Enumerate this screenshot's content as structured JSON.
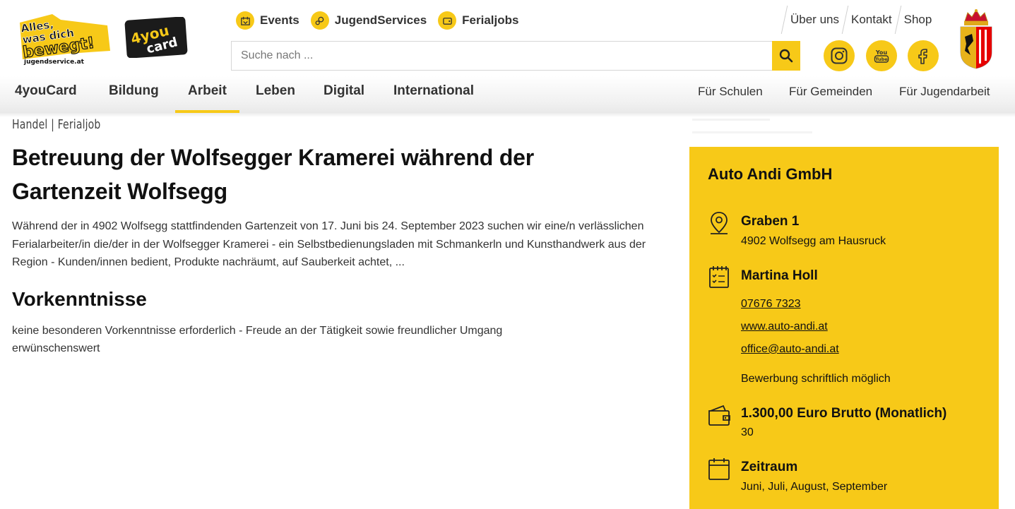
{
  "header": {
    "logo_main_text": [
      "Alles,",
      "was dich",
      "bewegt!",
      "jugendservice.at"
    ],
    "logo_card_text": [
      "4you",
      "card"
    ],
    "topnav": [
      {
        "label": "Events",
        "icon": "events-icon"
      },
      {
        "label": "JugendServices",
        "icon": "jugendservices-icon"
      },
      {
        "label": "Ferialjobs",
        "icon": "ferialjobs-icon"
      }
    ],
    "search": {
      "placeholder": "Suche nach ...",
      "value": ""
    },
    "utilnav": [
      "Über uns",
      "Kontakt",
      "Shop"
    ],
    "social": [
      "instagram-icon",
      "youtube-icon",
      "facebook-icon"
    ],
    "youtube_text": [
      "You",
      "Tube"
    ]
  },
  "mainnav": {
    "items": [
      "4youCard",
      "Bildung",
      "Arbeit",
      "Leben",
      "Digital",
      "International"
    ],
    "active": "Arbeit"
  },
  "subnav": [
    "Für Schulen",
    "Für Gemeinden",
    "Für Jugendarbeit"
  ],
  "article": {
    "breadcrumb": "Handel | Ferialjob",
    "title": "Betreuung der Wolfsegger Kramerei während der Gartenzeit Wolfsegg",
    "intro": "Während der in 4902 Wolfsegg stattfindenden Gartenzeit von 17. Juni bis 24. September 2023 suchen wir eine/n verlässlichen Ferialarbeiter/in die/der in der Wolfsegger Kramerei - ein Selbstbedienungsladen mit Schmankerln und Kunsthandwerk aus der Region - Kunden/innen bedient, Produkte nachräumt, auf Sauberkeit achtet, ...",
    "section_heading": "Vorkenntnisse",
    "section_text": "keine besonderen Vorkenntnisse erforderlich - Freude an der Tätigkeit sowie freundlicher Umgang erwünschenswert"
  },
  "sidebar": {
    "company": "Auto Andi GmbH",
    "address_street": "Graben 1",
    "address_city": "4902 Wolfsegg am Hausruck",
    "contact_name": "Martina Holl",
    "phone": "07676 7323",
    "website": "www.auto-andi.at",
    "email": "office@auto-andi.at",
    "application_note": "Bewerbung schriftlich möglich",
    "salary": "1.300,00 Euro Brutto (Monatlich)",
    "salary_detail": "30",
    "period_label": "Zeitraum",
    "period_value": "Juni, Juli, August, September"
  },
  "colors": {
    "accent": "#f7c918",
    "text": "#1a1a1a"
  }
}
